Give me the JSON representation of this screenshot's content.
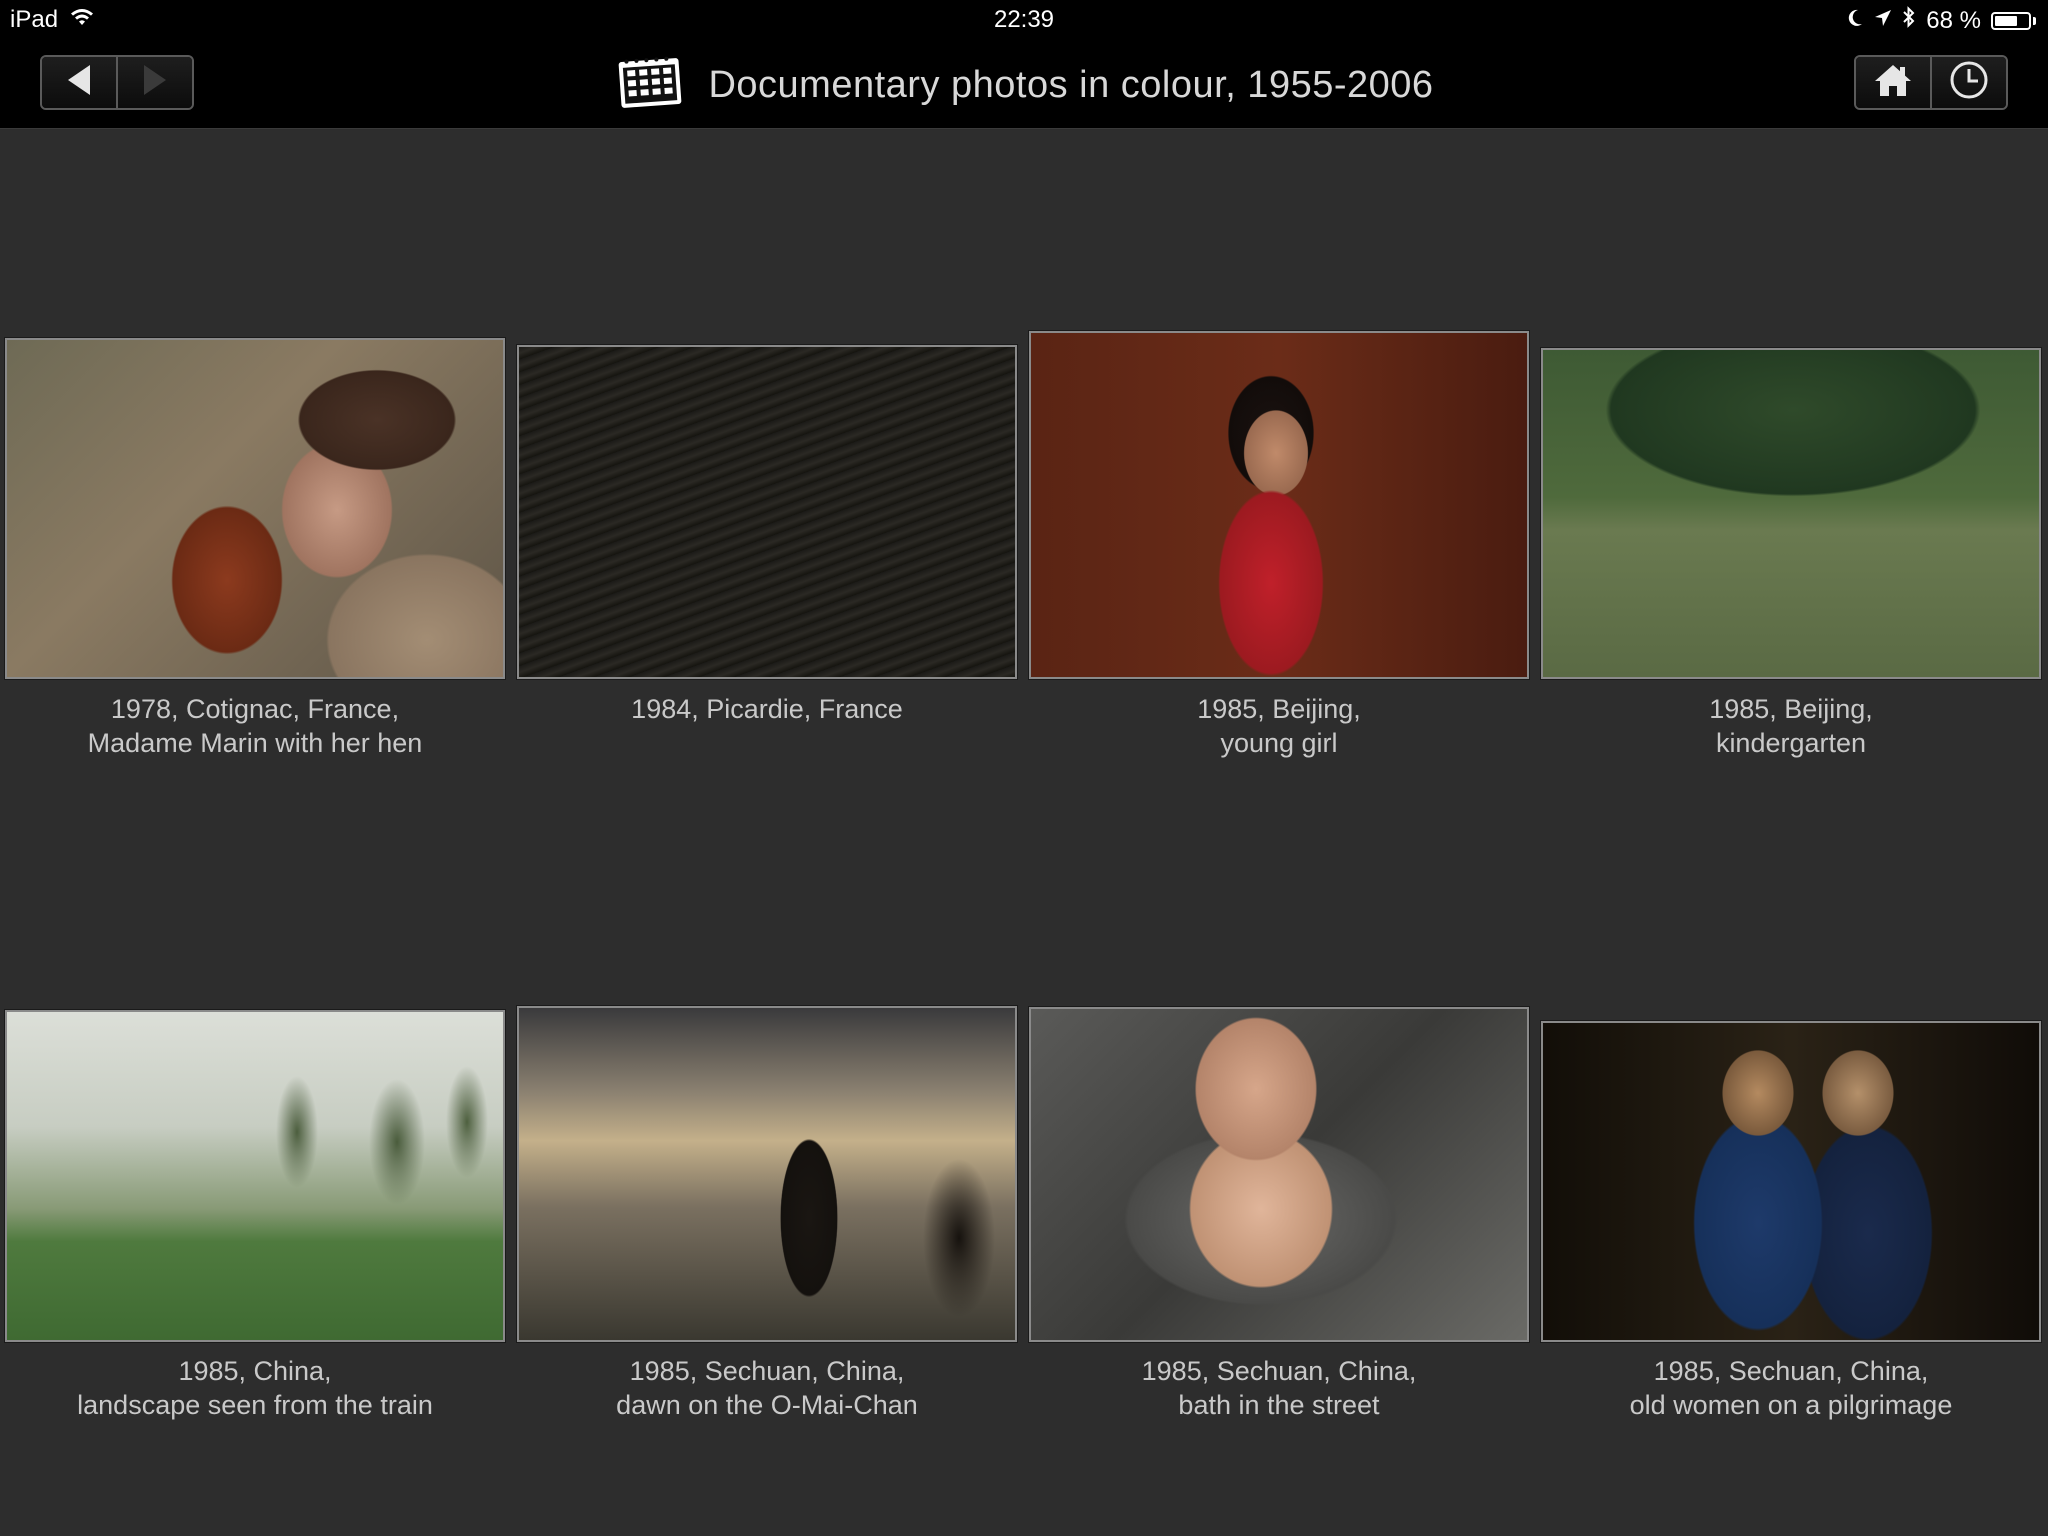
{
  "status_bar": {
    "device": "iPad",
    "time": "22:39",
    "battery": "68 %",
    "battery_level": 0.68,
    "icons": [
      "wifi-icon",
      "moon-icon",
      "location-arrow-icon",
      "bluetooth-icon",
      "battery-icon"
    ]
  },
  "nav": {
    "title": "Documentary photos in colour, 1955-2006",
    "left_buttons": [
      "back-arrow-icon",
      "forward-arrow-icon"
    ],
    "right_buttons": [
      "home-icon",
      "clock-icon"
    ],
    "title_icon": "contact-sheet-icon"
  },
  "photos": [
    {
      "line1": "1978, Cotignac, France,",
      "line2": "Madame Marin with her hen"
    },
    {
      "line1": "1984, Picardie, France",
      "line2": ""
    },
    {
      "line1": "1985, Beijing,",
      "line2": "young girl"
    },
    {
      "line1": "1985, Beijing,",
      "line2": "kindergarten"
    },
    {
      "line1": "1985, China,",
      "line2": "landscape seen from the train"
    },
    {
      "line1": "1985, Sechuan, China,",
      "line2": "dawn on the O-Mai-Chan"
    },
    {
      "line1": "1985, Sechuan, China,",
      "line2": "bath in the street"
    },
    {
      "line1": "1985, Sechuan, China,",
      "line2": "old women on a pilgrimage"
    }
  ],
  "colors": {
    "background": "#2d2d2d",
    "bar": "#000000",
    "text": "#c9c9c9"
  }
}
